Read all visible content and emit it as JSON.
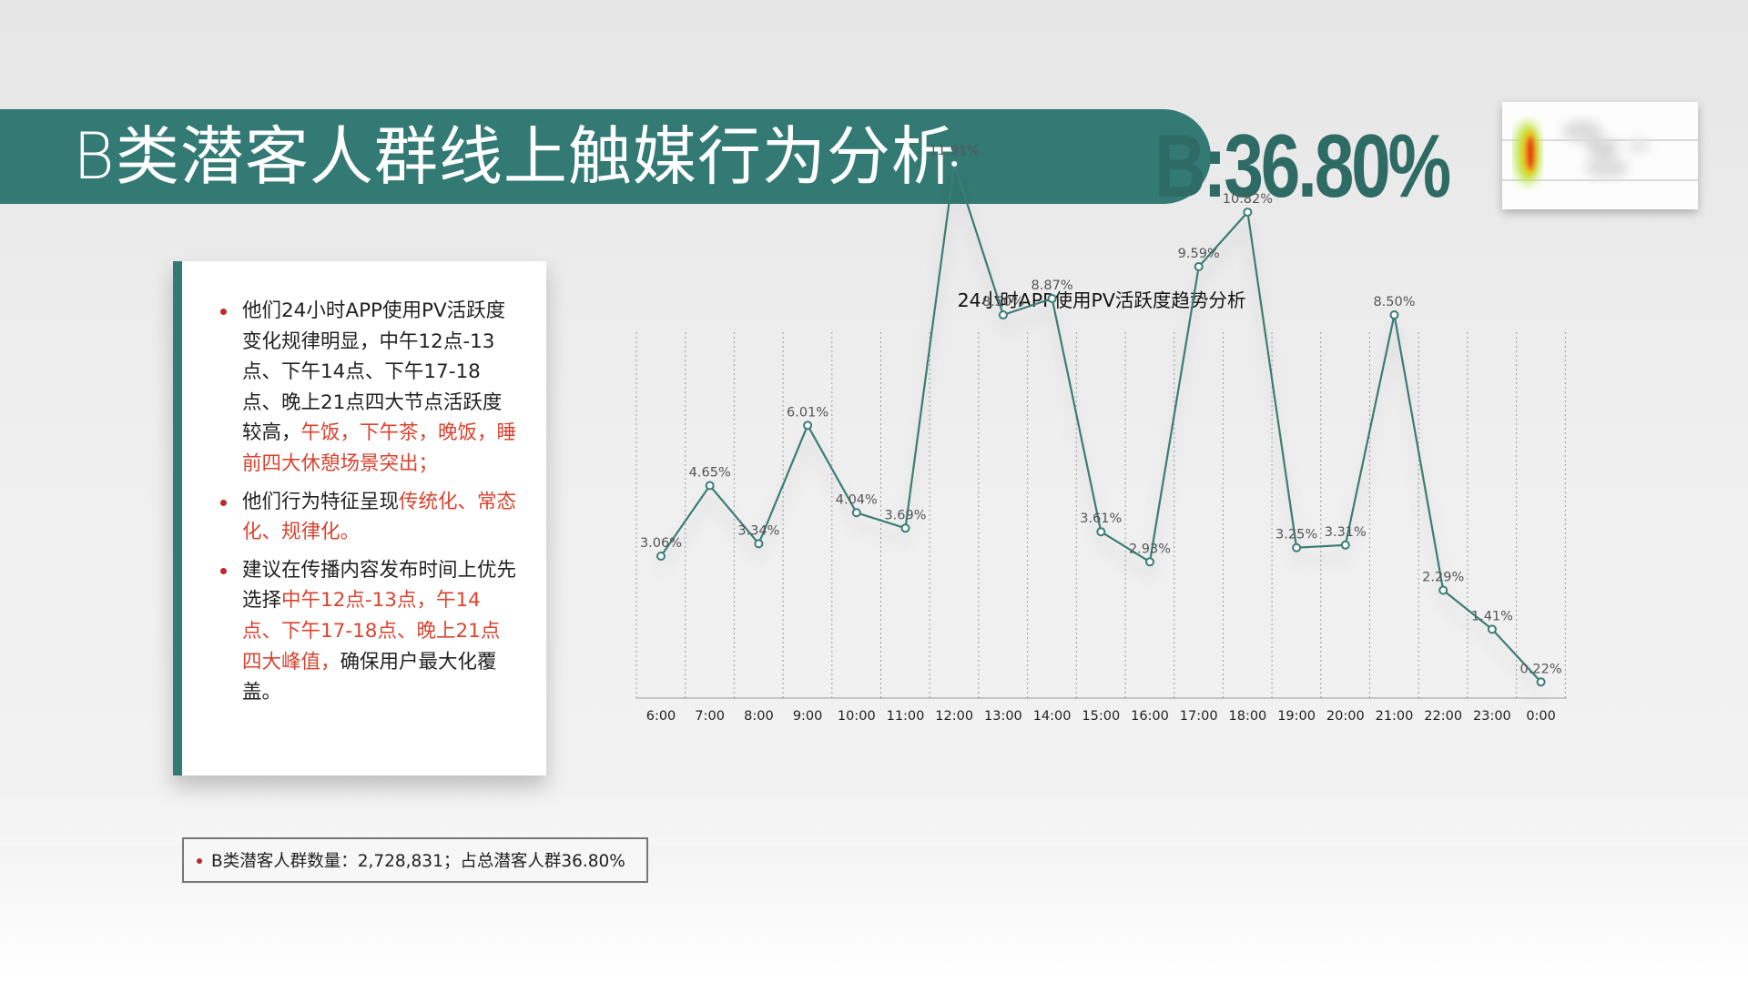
{
  "title": "B类潜客人群线上触媒行为分析",
  "highlight_percent": "B:36.80%",
  "notes": [
    {
      "segments": [
        {
          "text": "他们24小时APP使用PV活跃度变化规律明显，中午12点-13点、下午14点、下午17-18点、晚上21点四大节点活跃度较高，",
          "highlight": false
        },
        {
          "text": "午饭，下午茶，晚饭，睡前四大休憩场景突出；",
          "highlight": true
        }
      ]
    },
    {
      "segments": [
        {
          "text": "他们行为特征呈现",
          "highlight": false
        },
        {
          "text": "传统化、常态化、规律化。",
          "highlight": true
        }
      ]
    },
    {
      "segments": [
        {
          "text": "建议在传播内容发布时间上优先选择",
          "highlight": false
        },
        {
          "text": "中午12点-13点，午14点、下午17-18点、晚上21点四大峰值，",
          "highlight": true
        },
        {
          "text": "确保用户最大化覆盖。",
          "highlight": false
        }
      ]
    }
  ],
  "footer": "B类潜客人群数量：2,728,831；占总潜客人群36.80%",
  "colors": {
    "teal": "#327a73",
    "highlight_text": "#d9432f",
    "bullet": "#c0262d"
  },
  "chart_data": {
    "type": "line",
    "title": "24小时APP使用PV活跃度趋势分析",
    "categories": [
      "6:00",
      "7:00",
      "8:00",
      "9:00",
      "10:00",
      "11:00",
      "12:00",
      "13:00",
      "14:00",
      "15:00",
      "16:00",
      "17:00",
      "18:00",
      "19:00",
      "20:00",
      "21:00",
      "22:00",
      "23:00",
      "0:00"
    ],
    "series": [
      {
        "values": [
          3.06,
          4.65,
          3.34,
          6.01,
          4.04,
          3.69,
          11.91,
          8.5,
          8.87,
          3.61,
          2.93,
          9.59,
          10.82,
          3.25,
          3.31,
          8.5,
          2.29,
          1.41,
          0.22
        ],
        "labels": [
          "3.06%",
          "4.65%",
          "3.34%",
          "6.01%",
          "4.04%",
          "3.69%",
          "11.91%",
          "8.50%",
          "8.87%",
          "3.61%",
          "2.93%",
          "9.59%",
          "10.82%",
          "3.25%",
          "3.31%",
          "8.50%",
          "2.29%",
          "1.41%",
          "0.22%"
        ]
      }
    ],
    "ylim": [
      0,
      12
    ],
    "grid": "vertical dotted",
    "legend": "none",
    "line_color": "#3a7d76",
    "marker_fill": "#ffffff"
  }
}
